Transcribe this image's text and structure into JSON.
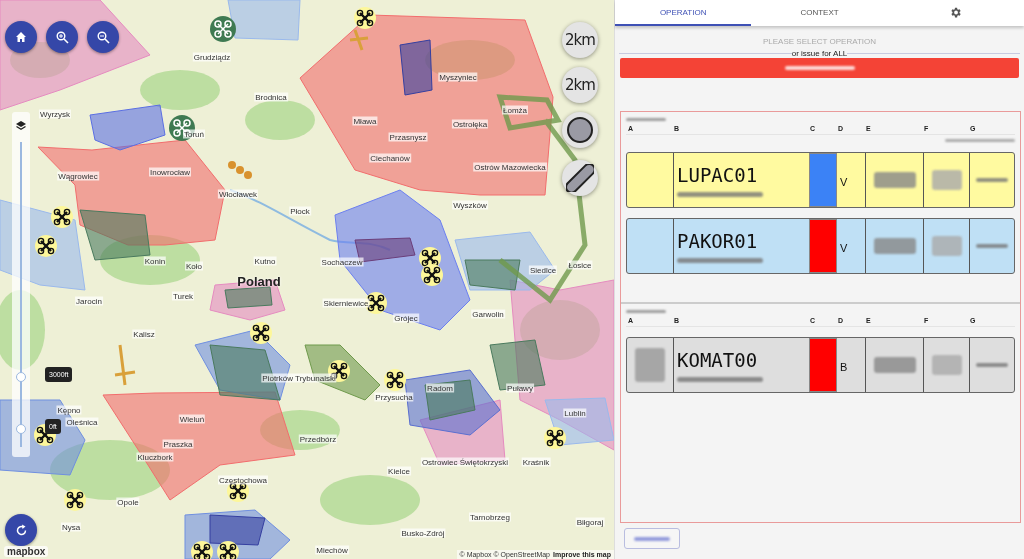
{
  "map": {
    "buttons": [
      {
        "kind": "home"
      },
      {
        "kind": "zoom-in"
      },
      {
        "kind": "zoom-out"
      }
    ],
    "tools": [
      {
        "kind": "radius",
        "label": "2km"
      },
      {
        "kind": "radius-rotate",
        "label": "2km"
      },
      {
        "kind": "circle"
      },
      {
        "kind": "pill"
      }
    ],
    "altitude_slider": {
      "handles": [
        {
          "label": "3000ft",
          "level": 0.23
        },
        {
          "label": "0ft",
          "level": 0.06
        }
      ]
    },
    "place_labels": [
      "Grudziądz",
      "Brodnica",
      "Wyrzysk",
      "Toruń",
      "Wągrowiec",
      "Inowrocław",
      "Włocławek",
      "Płock",
      "Mława",
      "Przasnysz",
      "Ciechanów",
      "Myszyniec",
      "Ostrołęka",
      "Łomża",
      "Ostrów Mazowiecka",
      "Wyszków",
      "Sochaczew",
      "Siedlce",
      "Łosice",
      "Kutno",
      "Koło",
      "Konin",
      "Turek",
      "Skierniewice",
      "Grójec",
      "Garwolin",
      "Kalisz",
      "Jarocin",
      "Piotrków Trybunalski",
      "Przysucha",
      "Radom",
      "Puławy",
      "Lublin",
      "Kępno",
      "Wieluń",
      "Oleśnica",
      "Praszka",
      "Kluczbork",
      "Przedbórz",
      "Częstochowa",
      "Opole",
      "Nysa",
      "Kielce",
      "Ostrowiec Świętokrzyski",
      "Kraśnik",
      "Busko-Zdrój",
      "Tarnobrzeg",
      "Biłgoraj",
      "Miechów"
    ],
    "country_label": "Poland",
    "logo": "mapbox",
    "attribution": {
      "text": "© Mapbox © OpenStreetMap",
      "link": "Improve this map"
    }
  },
  "tabs": [
    {
      "kind": "text",
      "label": "OPERATION",
      "selected": true
    },
    {
      "kind": "text",
      "label": "CONTEXT",
      "selected": false
    },
    {
      "kind": "settings",
      "selected": false
    }
  ],
  "prompt": "PLEASE SELECT OPERATION",
  "divider_text": "or issue for ALL",
  "groups": [
    {
      "columns": [
        "A",
        "B",
        "C",
        "D",
        "E",
        "F",
        "G"
      ],
      "rows": [
        {
          "kind": "pending",
          "callsign": "LUPAC01",
          "color": "#3b82f6",
          "code": "V",
          "icon": false
        },
        {
          "kind": "active",
          "callsign": "PAKOR01",
          "color": "#ff0000",
          "code": "V",
          "icon": false
        }
      ]
    },
    {
      "columns": [
        "A",
        "B",
        "C",
        "D",
        "E",
        "F",
        "G"
      ],
      "rows": [
        {
          "kind": "inactive",
          "callsign": "KOMAT00",
          "color": "#ff0000",
          "code": "B",
          "icon": true
        }
      ]
    }
  ]
}
